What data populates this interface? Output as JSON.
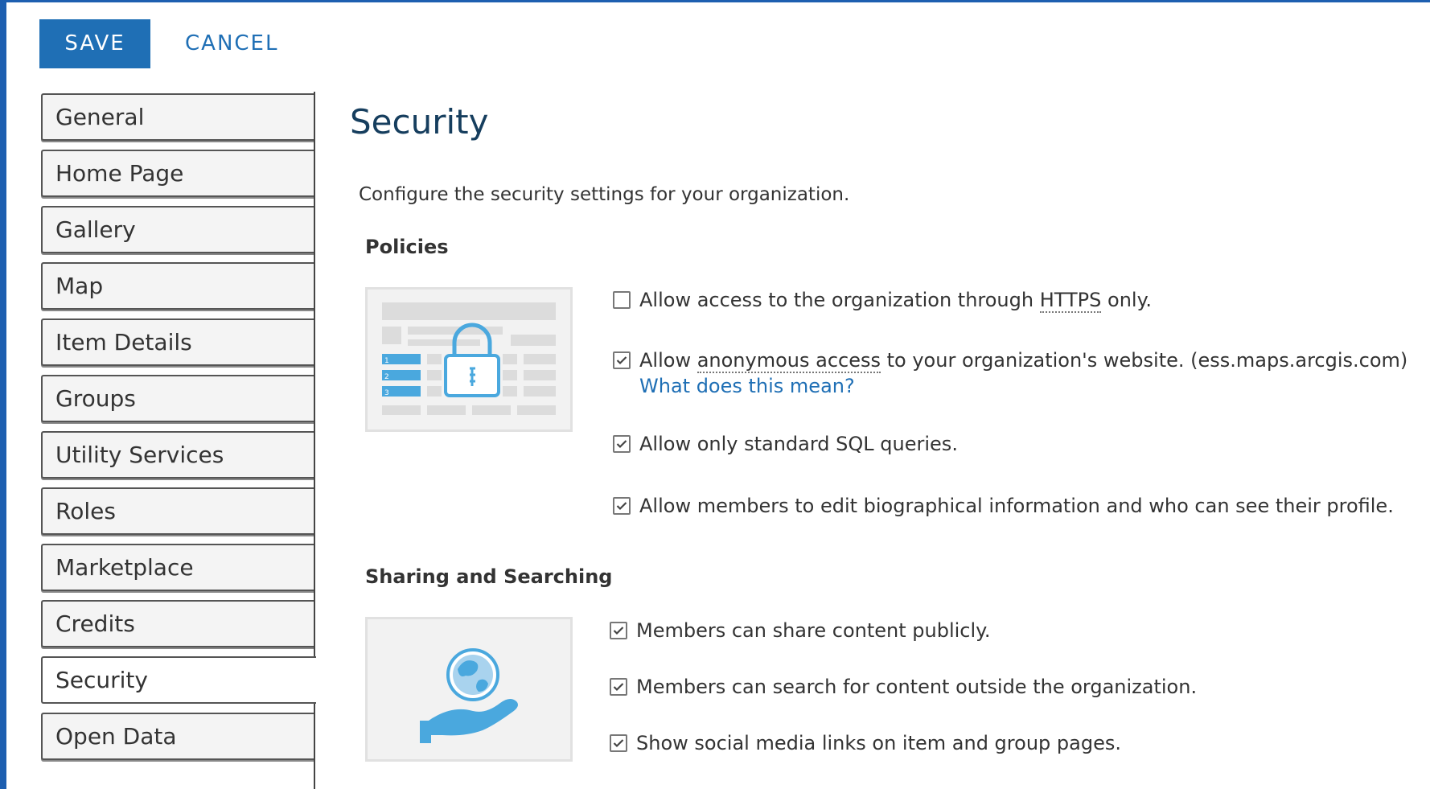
{
  "toolbar": {
    "save_label": "SAVE",
    "cancel_label": "CANCEL"
  },
  "sidebar": {
    "items": [
      {
        "label": "General"
      },
      {
        "label": "Home Page"
      },
      {
        "label": "Gallery"
      },
      {
        "label": "Map"
      },
      {
        "label": "Item Details"
      },
      {
        "label": "Groups"
      },
      {
        "label": "Utility Services"
      },
      {
        "label": "Roles"
      },
      {
        "label": "Marketplace"
      },
      {
        "label": "Credits"
      },
      {
        "label": "Security",
        "active": true
      },
      {
        "label": "Open Data"
      }
    ]
  },
  "main": {
    "title": "Security",
    "description": "Configure the security settings for your organization.",
    "policies": {
      "heading": "Policies",
      "illustration_icon": "lock-document-icon",
      "options": [
        {
          "checked": false,
          "text_before": "Allow access to the organization through ",
          "term": "HTTPS",
          "text_after": " only."
        },
        {
          "checked": true,
          "text_before": "Allow ",
          "term": "anonymous access",
          "text_after": " to your organization's website. (ess.maps.arcgis.com)",
          "link": "What does this mean?"
        },
        {
          "checked": true,
          "text": "Allow only standard SQL queries."
        },
        {
          "checked": true,
          "text": "Allow members to edit biographical information and who can see their profile."
        }
      ]
    },
    "sharing": {
      "heading": "Sharing and Searching",
      "illustration_icon": "globe-in-hand-icon",
      "options": [
        {
          "checked": true,
          "text": "Members can share content publicly."
        },
        {
          "checked": true,
          "text": "Members can search for content outside the organization."
        },
        {
          "checked": true,
          "text": "Show social media links on item and group pages."
        }
      ]
    }
  },
  "colors": {
    "accent": "#1f6fb5",
    "frame": "#1d5fb0",
    "title": "#163e5e"
  }
}
